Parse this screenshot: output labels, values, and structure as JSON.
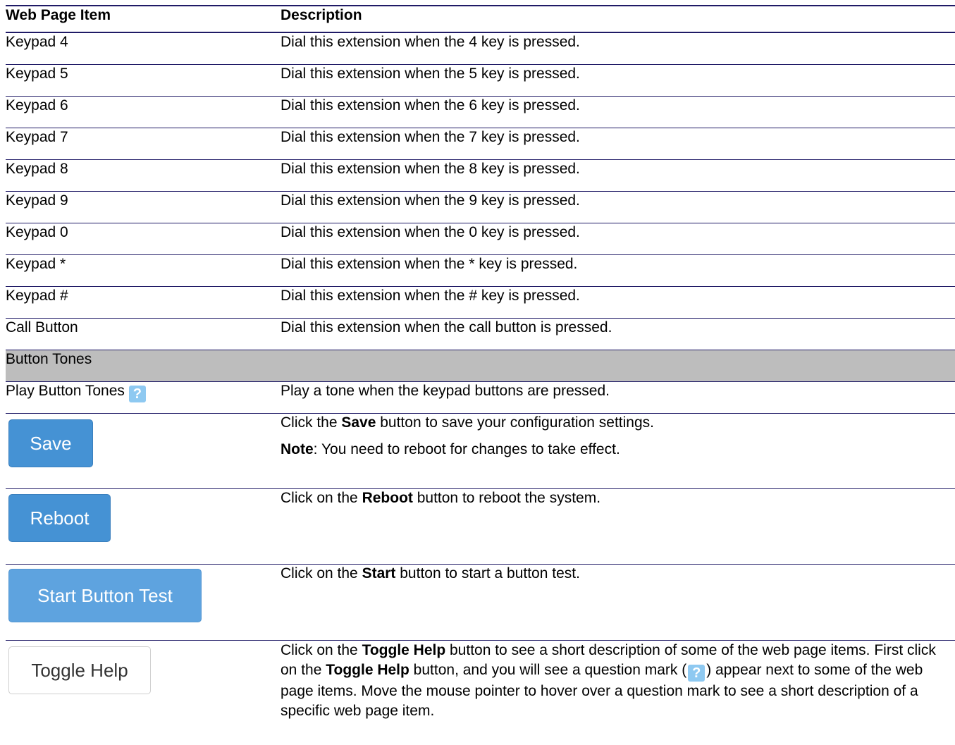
{
  "table": {
    "headers": [
      "Web Page Item",
      "Description"
    ],
    "rows": [
      {
        "item": "Keypad 4",
        "desc": "Dial this extension when the 4 key is pressed."
      },
      {
        "item": "Keypad 5",
        "desc": "Dial this extension when the 5 key is pressed."
      },
      {
        "item": "Keypad 6",
        "desc": "Dial this extension when the 6 key is pressed."
      },
      {
        "item": "Keypad 7",
        "desc": "Dial this extension when the 7 key is pressed."
      },
      {
        "item": "Keypad 8",
        "desc": "Dial this extension when the 8 key is pressed."
      },
      {
        "item": "Keypad 9",
        "desc": "Dial this extension when the 9 key is pressed."
      },
      {
        "item": "Keypad 0",
        "desc": "Dial this extension when the 0 key is pressed."
      },
      {
        "item": "Keypad *",
        "desc": "Dial this extension when the * key is pressed."
      },
      {
        "item": "Keypad #",
        "desc": "Dial this extension when the # key is pressed."
      },
      {
        "item": "Call Button",
        "desc": "Dial this extension when the call button is pressed."
      }
    ],
    "section": "Button Tones",
    "play_tones": {
      "item": "Play Button Tones",
      "help_icon": "?",
      "desc": "Play a tone when the keypad buttons are pressed."
    },
    "save": {
      "button": "Save",
      "desc_pre": "Click the ",
      "desc_bold": "Save",
      "desc_post": " button to save your configuration settings.",
      "note_bold": "Note",
      "note_text": ": You need to reboot for changes to take effect."
    },
    "reboot": {
      "button": "Reboot",
      "desc_pre": "Click on the ",
      "desc_bold": "Reboot",
      "desc_post": " button to reboot the system."
    },
    "start_test": {
      "button": "Start Button Test",
      "desc_pre": "Click on the ",
      "desc_bold": "Start",
      "desc_post": " button to start a button test."
    },
    "toggle_help": {
      "button": "Toggle Help",
      "t1": "Click on the ",
      "b1": "Toggle Help",
      "t2": " button to see a short description of some of the web page items. First click on the ",
      "b2": "Toggle Help",
      "t3": " button, and you will see a question mark (",
      "icon": "?",
      "t4": ") appear next to some of the web page items. Move the mouse pointer to hover over a question mark to see a short description of a specific web page item."
    }
  },
  "colors": {
    "rule": "#1f1a66",
    "section_bg": "#bdbdbd",
    "primary_button": "#4592d4",
    "help_icon": "#8ec9f1"
  }
}
